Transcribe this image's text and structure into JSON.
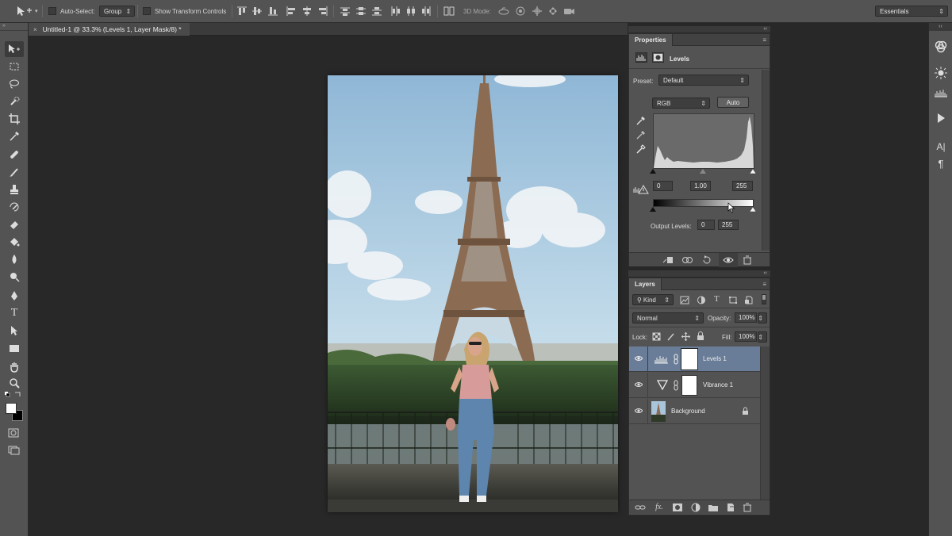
{
  "options_bar": {
    "auto_select_label": "Auto-Select:",
    "auto_select_value": "Group",
    "show_transform_label": "Show Transform Controls",
    "mode_3d_label": "3D Mode:",
    "workspace_value": "Essentials"
  },
  "document": {
    "tab_title": "Untitled-1 @ 33.3% (Levels 1, Layer Mask/8) *",
    "close_glyph": "×"
  },
  "properties": {
    "panel_title": "Properties",
    "adjustment_title": "Levels",
    "preset_label": "Preset:",
    "preset_value": "Default",
    "channel_value": "RGB",
    "auto_label": "Auto",
    "input_black": "0",
    "input_gamma": "1.00",
    "input_white": "255",
    "output_label": "Output Levels:",
    "output_black": "0",
    "output_white": "255"
  },
  "layers": {
    "panel_title": "Layers",
    "filter_value": "Kind",
    "blend_mode": "Normal",
    "opacity_label": "Opacity:",
    "opacity_value": "100%",
    "lock_label": "Lock:",
    "fill_label": "Fill:",
    "fill_value": "100%",
    "items": [
      {
        "name": "Levels 1",
        "selected": true,
        "kind": "levels-adjustment"
      },
      {
        "name": "Vibrance 1",
        "selected": false,
        "kind": "vibrance-adjustment"
      },
      {
        "name": "Background",
        "selected": false,
        "kind": "image",
        "locked": true
      }
    ]
  },
  "icons": {
    "move_tool": "move-tool-icon",
    "marquee": "rectangular-marquee-icon",
    "lasso": "lasso-icon",
    "quick_select": "quick-selection-icon",
    "crop": "crop-icon",
    "eyedropper": "eyedropper-icon",
    "healing": "spot-healing-icon",
    "brush": "brush-icon",
    "stamp": "clone-stamp-icon",
    "history_brush": "history-brush-icon",
    "eraser": "eraser-icon",
    "bucket": "paint-bucket-icon",
    "blur": "blur-icon",
    "dodge": "dodge-icon",
    "pen": "pen-icon",
    "type": "type-icon",
    "path_select": "path-selection-icon",
    "rectangle": "rectangle-shape-icon",
    "hand": "hand-icon",
    "zoom": "zoom-icon"
  },
  "colors": {
    "selected_layer": "#6a7d98",
    "panel_bg": "#535353",
    "canvas_bg": "#282828"
  }
}
